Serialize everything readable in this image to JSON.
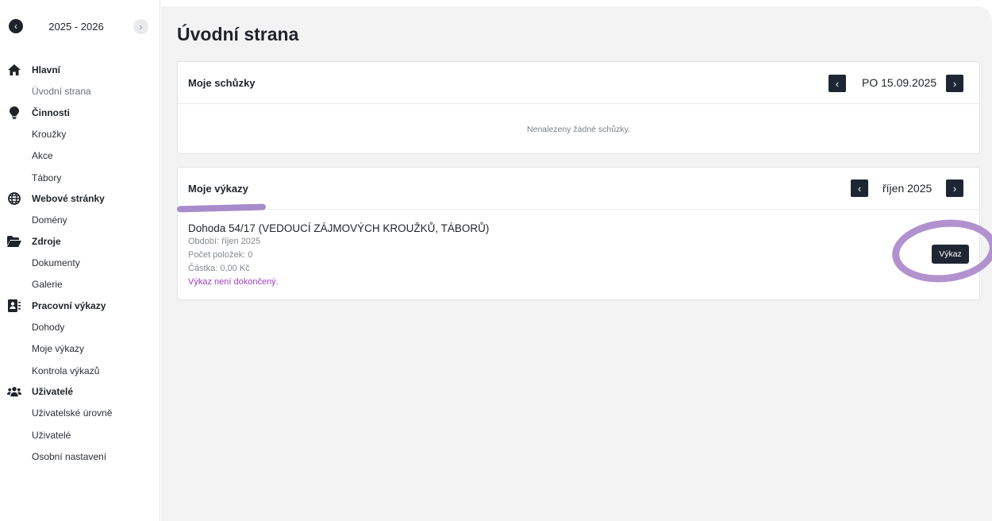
{
  "sidebar": {
    "year_label": "2025 - 2026",
    "prev_icon": "chevron-left-icon",
    "next_icon": "chevron-right-icon",
    "groups": [
      {
        "label": "Hlavní",
        "icon": "home-icon",
        "items": [
          {
            "label": "Úvodní strana",
            "active": true
          }
        ]
      },
      {
        "label": "Činnosti",
        "icon": "lightbulb-icon",
        "items": [
          {
            "label": "Kroužky"
          },
          {
            "label": "Akce"
          },
          {
            "label": "Tábory"
          }
        ]
      },
      {
        "label": "Webové stránky",
        "icon": "globe-icon",
        "items": [
          {
            "label": "Domény"
          }
        ]
      },
      {
        "label": "Zdroje",
        "icon": "folder-open-icon",
        "items": [
          {
            "label": "Dokumenty"
          },
          {
            "label": "Galerie"
          }
        ]
      },
      {
        "label": "Pracovní výkazy",
        "icon": "id-card-icon",
        "items": [
          {
            "label": "Dohody"
          },
          {
            "label": "Moje výkazy"
          },
          {
            "label": "Kontrola výkazů"
          }
        ]
      },
      {
        "label": "Uživatelé",
        "icon": "users-icon",
        "items": [
          {
            "label": "Uživatelské úrovně"
          },
          {
            "label": "Uživatelé"
          },
          {
            "label": "Osobní nastavení"
          }
        ]
      }
    ]
  },
  "main": {
    "title": "Úvodní strana",
    "meetings": {
      "title": "Moje schůzky",
      "date_label": "PO 15.09.2025",
      "empty_text": "Nenalezeny žádné schůzky."
    },
    "reports": {
      "title": "Moje výkazy",
      "month_label": "říjen 2025",
      "item": {
        "title": "Dohoda 54/17 (VEDOUCÍ ZÁJMOVÝCH KROUŽKŮ, TÁBORŮ)",
        "period": "Období: říjen 2025",
        "count": "Počet položek: 0",
        "amount": "Částka: 0,00 Kč",
        "status": "Výkaz není dokončený.",
        "button_label": "Výkaz"
      }
    }
  },
  "colors": {
    "accent_dark": "#1f2633",
    "status_purple": "#a23cc4",
    "annotation": "#ad8ccc"
  }
}
